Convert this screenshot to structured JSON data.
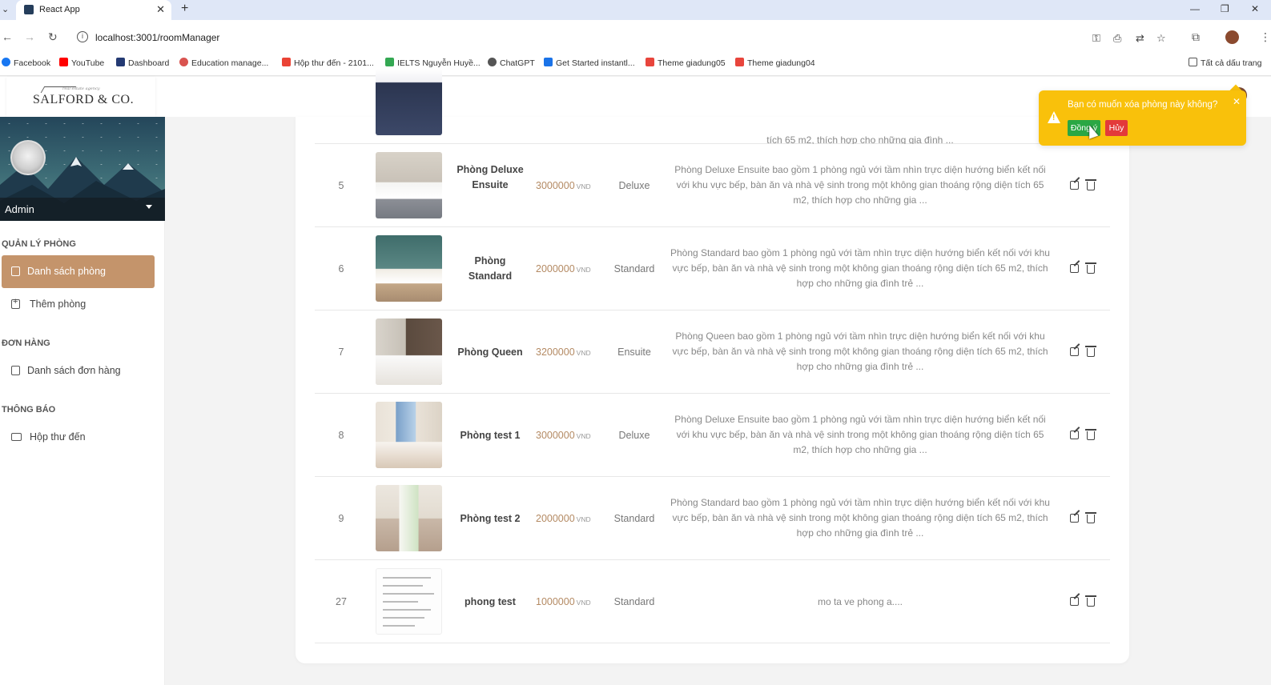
{
  "browser": {
    "tab_title": "React App",
    "url": "localhost:3001/roomManager",
    "bookmarks": [
      "Facebook",
      "YouTube",
      "Dashboard",
      "Education manage...",
      "Hộp thư đến - 2101...",
      "IELTS Nguyễn Huyề...",
      "ChatGPT",
      "Get Started instantl...",
      "Theme giadung05",
      "Theme giadung04"
    ],
    "all_bookmarks": "Tất cả dấu trang"
  },
  "logo": {
    "tagline": "real estate agency",
    "text": "SALFORD & CO."
  },
  "user": {
    "name": "Admin"
  },
  "sidebar": {
    "sections": [
      {
        "title": "QUẢN LÝ PHÒNG",
        "items": [
          "Danh sách phòng",
          "Thêm phòng"
        ]
      },
      {
        "title": "ĐƠN HÀNG",
        "items": [
          "Danh sách đơn hàng"
        ]
      },
      {
        "title": "THÔNG BÁO",
        "items": [
          "Hộp thư đến"
        ]
      }
    ]
  },
  "partial_row_desc": "tích 65 m2, thích hợp cho những gia đình ...",
  "rooms": [
    {
      "id": "5",
      "name": "Phòng Deluxe Ensuite",
      "price": "3000000",
      "currency": "VND",
      "type": "Deluxe",
      "desc": "Phòng Deluxe Ensuite bao gồm 1 phòng ngủ với tầm nhìn trực diện hướng biển kết nối với khu vực bếp, bàn ăn và nhà vệ sinh trong một không gian thoáng rộng diện tích 65 m2, thích hợp cho những gia ..."
    },
    {
      "id": "6",
      "name": "Phòng Standard",
      "price": "2000000",
      "currency": "VND",
      "type": "Standard",
      "desc": "Phòng Standard bao gồm 1 phòng ngủ với tầm nhìn trực diện hướng biển kết nối với khu vực bếp, bàn ăn và nhà vệ sinh trong một không gian thoáng rộng diện tích 65 m2, thích hợp cho những gia đình trẻ ..."
    },
    {
      "id": "7",
      "name": "Phòng Queen",
      "price": "3200000",
      "currency": "VND",
      "type": "Ensuite",
      "desc": "Phòng Queen bao gồm 1 phòng ngủ với tầm nhìn trực diện hướng biển kết nối với khu vực bếp, bàn ăn và nhà vệ sinh trong một không gian thoáng rộng diện tích 65 m2, thích hợp cho những gia đình trẻ ..."
    },
    {
      "id": "8",
      "name": "Phòng test 1",
      "price": "3000000",
      "currency": "VND",
      "type": "Deluxe",
      "desc": "Phòng Deluxe Ensuite bao gồm 1 phòng ngủ với tầm nhìn trực diện hướng biển kết nối với khu vực bếp, bàn ăn và nhà vệ sinh trong một không gian thoáng rộng diện tích 65 m2, thích hợp cho những gia ..."
    },
    {
      "id": "9",
      "name": "Phòng test 2",
      "price": "2000000",
      "currency": "VND",
      "type": "Standard",
      "desc": "Phòng Standard bao gồm 1 phòng ngủ với tầm nhìn trực diện hướng biển kết nối với khu vực bếp, bàn ăn và nhà vệ sinh trong một không gian thoáng rộng diện tích 65 m2, thích hợp cho những gia đình trẻ ..."
    },
    {
      "id": "27",
      "name": "phong test",
      "price": "1000000",
      "currency": "VND",
      "type": "Standard",
      "desc": "mo ta ve phong a...."
    }
  ],
  "popconfirm": {
    "message": "Bạn có muốn xóa phòng này không?",
    "ok": "Đồng ý",
    "cancel": "Hủy"
  },
  "colors": {
    "accent": "#c4946b",
    "price": "#b48a63",
    "warning": "#f9c10b",
    "confirm": "#2aa744",
    "cancel": "#e33a3a"
  }
}
